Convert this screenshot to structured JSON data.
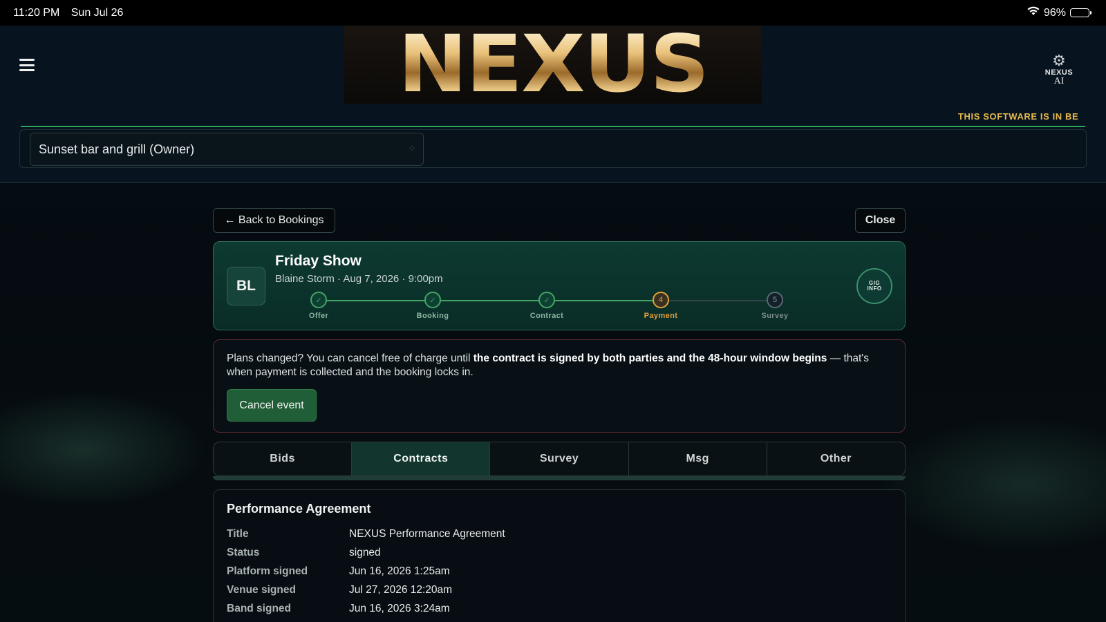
{
  "status_bar": {
    "time": "11:20 PM",
    "date": "Sun Jul 26",
    "battery": "96%"
  },
  "header": {
    "logo_text": "NEXUS",
    "ai_badge_line1": "NEXUS",
    "ai_badge_line2": "AI",
    "beta_banner": "THIS SOFTWARE IS IN BE",
    "venue_selected": "Sunset bar and grill (Owner)"
  },
  "nav": {
    "back_label": "← Back to Bookings",
    "close_label": "Close"
  },
  "gig": {
    "avatar_initials": "BL",
    "title": "Friday Show",
    "subtitle": "Blaine Storm · Aug 7, 2026 · 9:00pm",
    "info_line1": "GIG",
    "info_line2": "INFO",
    "steps": [
      {
        "label": "Offer",
        "state": "done",
        "mark": "✓"
      },
      {
        "label": "Booking",
        "state": "done",
        "mark": "✓"
      },
      {
        "label": "Contract",
        "state": "done",
        "mark": "✓"
      },
      {
        "label": "Payment",
        "state": "active",
        "mark": "4"
      },
      {
        "label": "Survey",
        "state": "todo",
        "mark": "5"
      }
    ]
  },
  "notice": {
    "text_before": "Plans changed? You can cancel free of charge until ",
    "text_bold": "the contract is signed by both parties and the 48-hour window begins",
    "text_after": " — that's when payment is collected and the booking locks in.",
    "cancel_label": "Cancel event"
  },
  "tabs": [
    {
      "label": "Bids",
      "active": false
    },
    {
      "label": "Contracts",
      "active": true
    },
    {
      "label": "Survey",
      "active": false
    },
    {
      "label": "Msg",
      "active": false
    },
    {
      "label": "Other",
      "active": false
    }
  ],
  "agreement": {
    "heading": "Performance Agreement",
    "rows": [
      {
        "key": "Title",
        "value": "NEXUS Performance Agreement"
      },
      {
        "key": "Status",
        "value": "signed"
      },
      {
        "key": "Platform signed",
        "value": "Jun 16, 2026 1:25am"
      },
      {
        "key": "Venue signed",
        "value": "Jul 27, 2026 12:20am"
      },
      {
        "key": "Band signed",
        "value": "Jun 16, 2026 3:24am"
      }
    ]
  },
  "colors": {
    "accent_green": "#43a564",
    "payment_orange": "#e2a23a",
    "beta_yellow": "#e8b94a"
  }
}
